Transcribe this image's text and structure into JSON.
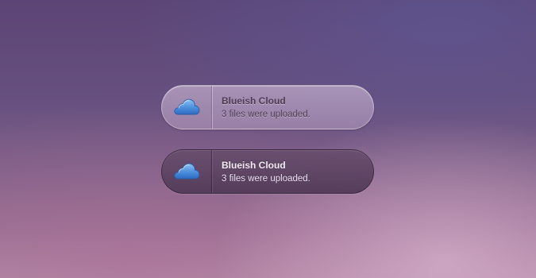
{
  "notifications": [
    {
      "variant": "light",
      "icon": "cloud-icon",
      "title": "Blueish Cloud",
      "message": "3 files were uploaded."
    },
    {
      "variant": "dark",
      "icon": "cloud-icon",
      "title": "Blueish Cloud",
      "message": "3 files were uploaded."
    }
  ],
  "colors": {
    "cloud_top": "#7fb4ec",
    "cloud_bottom": "#2f6fca",
    "cloud_outline": "#2a5ea8"
  }
}
